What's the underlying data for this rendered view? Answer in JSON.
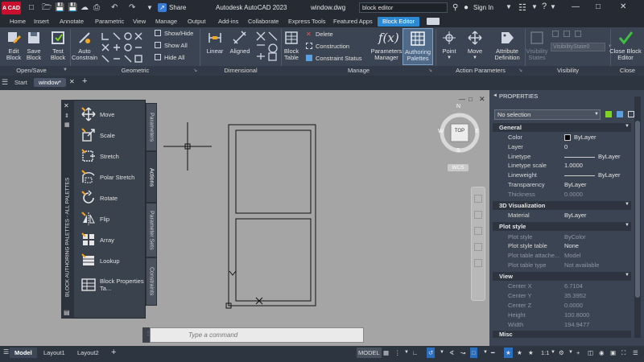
{
  "titlebar": {
    "app_logo": "A CAD",
    "share": "Share",
    "app_title": "Autodesk AutoCAD 2023",
    "file_name": "window.dwg",
    "search_value": "block editor",
    "signin": "Sign In"
  },
  "menu": [
    "Home",
    "Insert",
    "Annotate",
    "Parametric",
    "View",
    "Manage",
    "Output",
    "Add-ins",
    "Collaborate",
    "Express Tools",
    "Featured Apps",
    "Block Editor"
  ],
  "ribbon": {
    "open_save": [
      "Edit Block",
      "Save Block",
      "Test Block"
    ],
    "auto_constrain": "Auto Constrain",
    "show_hide": [
      "Show/Hide",
      "Show All",
      "Hide All"
    ],
    "linear": "Linear",
    "aligned": "Aligned",
    "block_table": "Block Table",
    "manage_small": [
      "Delete",
      "Construction",
      "Constraint Status"
    ],
    "parameters_manager": "Parameters Manager",
    "authoring_palettes": "Authoring Palettes",
    "point": "Point",
    "move": "Move",
    "attribute_definition": "Attribute Definition",
    "visibility_states": "Visibility States",
    "visibility_state_value": "VisibilityState0",
    "close_block_editor": "Close Block Editor",
    "groups": [
      "Open/Save",
      "Geometric",
      "Dimensional",
      "Manage",
      "Action Parameters",
      "Visibility",
      "Close"
    ]
  },
  "doc_tabs": [
    "Start",
    "window*"
  ],
  "viewcube": {
    "top": "TOP",
    "n": "N",
    "s": "S",
    "e": "E",
    "w": "W",
    "wcs": "WCS"
  },
  "palette": {
    "title": "BLOCK AUTHORING PALETTES - ALL PALETTES",
    "tabs": [
      "Parameters",
      "Actions",
      "Parameter Sets",
      "Constraints"
    ],
    "items": [
      "Move",
      "Scale",
      "Stretch",
      "Polar Stretch",
      "Rotate",
      "Flip",
      "Array",
      "Lookup",
      "Block Properties Ta..."
    ]
  },
  "command_placeholder": "Type a command",
  "properties": {
    "title": "PROPERTIES",
    "selection": "No selection",
    "sections": {
      "general": "General",
      "viz": "3D Visualization",
      "plot": "Plot style",
      "view": "View",
      "misc": "Misc"
    },
    "general": [
      {
        "k": "Color",
        "v": "ByLayer"
      },
      {
        "k": "Layer",
        "v": "0"
      },
      {
        "k": "Linetype",
        "v": "ByLayer"
      },
      {
        "k": "Linetype scale",
        "v": "1.0000"
      },
      {
        "k": "Lineweight",
        "v": "ByLayer"
      },
      {
        "k": "Transparency",
        "v": "ByLayer"
      },
      {
        "k": "Thickness",
        "v": "0.0000"
      }
    ],
    "viz": [
      {
        "k": "Material",
        "v": "ByLayer"
      }
    ],
    "plot": [
      {
        "k": "Plot style",
        "v": "ByColor"
      },
      {
        "k": "Plot style table",
        "v": "None"
      },
      {
        "k": "Plot table attache...",
        "v": "Model"
      },
      {
        "k": "Plot table type",
        "v": "Not available"
      }
    ],
    "view": [
      {
        "k": "Center X",
        "v": "6.7104"
      },
      {
        "k": "Center Y",
        "v": "35.3952"
      },
      {
        "k": "Center Z",
        "v": "0.0000"
      },
      {
        "k": "Height",
        "v": "100.8000"
      },
      {
        "k": "Width",
        "v": "194.9477"
      }
    ]
  },
  "status": {
    "layout_tabs": [
      "Model",
      "Layout1",
      "Layout2"
    ],
    "model": "MODEL",
    "scale": "1:1"
  }
}
